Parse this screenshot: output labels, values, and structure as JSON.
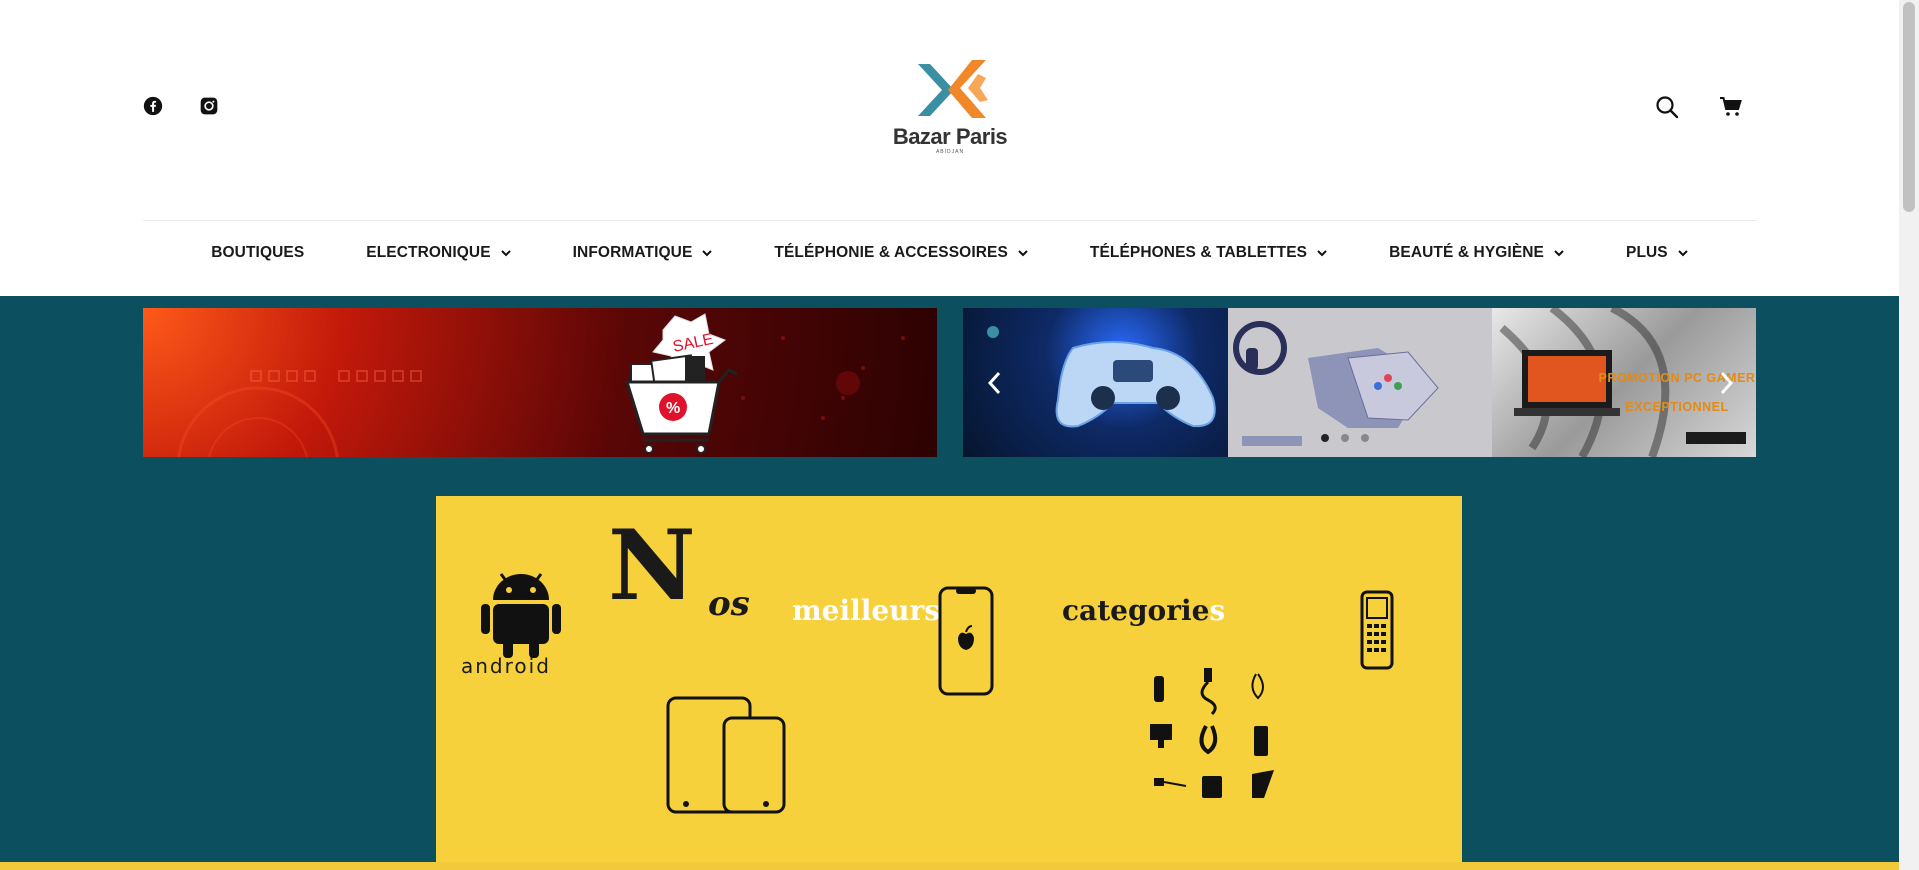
{
  "brand": {
    "name": "Bazar Paris",
    "sub": "ABIDJAN",
    "colors": {
      "teal": "#3a8fa3",
      "orange": "#f0882a",
      "background": "#0c4f5f",
      "yellow": "#f7d13c"
    }
  },
  "header": {
    "social": [
      {
        "name": "facebook-icon"
      },
      {
        "name": "instagram-icon"
      }
    ],
    "tools": [
      {
        "name": "search-icon"
      },
      {
        "name": "cart-icon"
      }
    ]
  },
  "nav": {
    "items": [
      {
        "label": "BOUTIQUES",
        "has_dropdown": false
      },
      {
        "label": "ELECTRONIQUE",
        "has_dropdown": true
      },
      {
        "label": "INFORMATIQUE",
        "has_dropdown": true
      },
      {
        "label": "TÉLÉPHONIE & ACCESSOIRES",
        "has_dropdown": true
      },
      {
        "label": "TÉLÉPHONES & TABLETTES",
        "has_dropdown": true
      },
      {
        "label": "BEAUTÉ & HYGIÈNE",
        "has_dropdown": true
      },
      {
        "label": "PLUS",
        "has_dropdown": true
      }
    ]
  },
  "banner": {
    "sale_tag": "SALE",
    "percent": "%"
  },
  "slider": {
    "promo_line1": "PROMOTION PC GAMER",
    "promo_line2": "EXCEPTIONNEL",
    "dots_total": 3,
    "active_dot": 1
  },
  "category_banner": {
    "big_letter": "N",
    "word_nos": "os",
    "word_best": "meilleurs",
    "word_categories": "categorie",
    "word_categories_tail": "s",
    "android_label": "android"
  }
}
